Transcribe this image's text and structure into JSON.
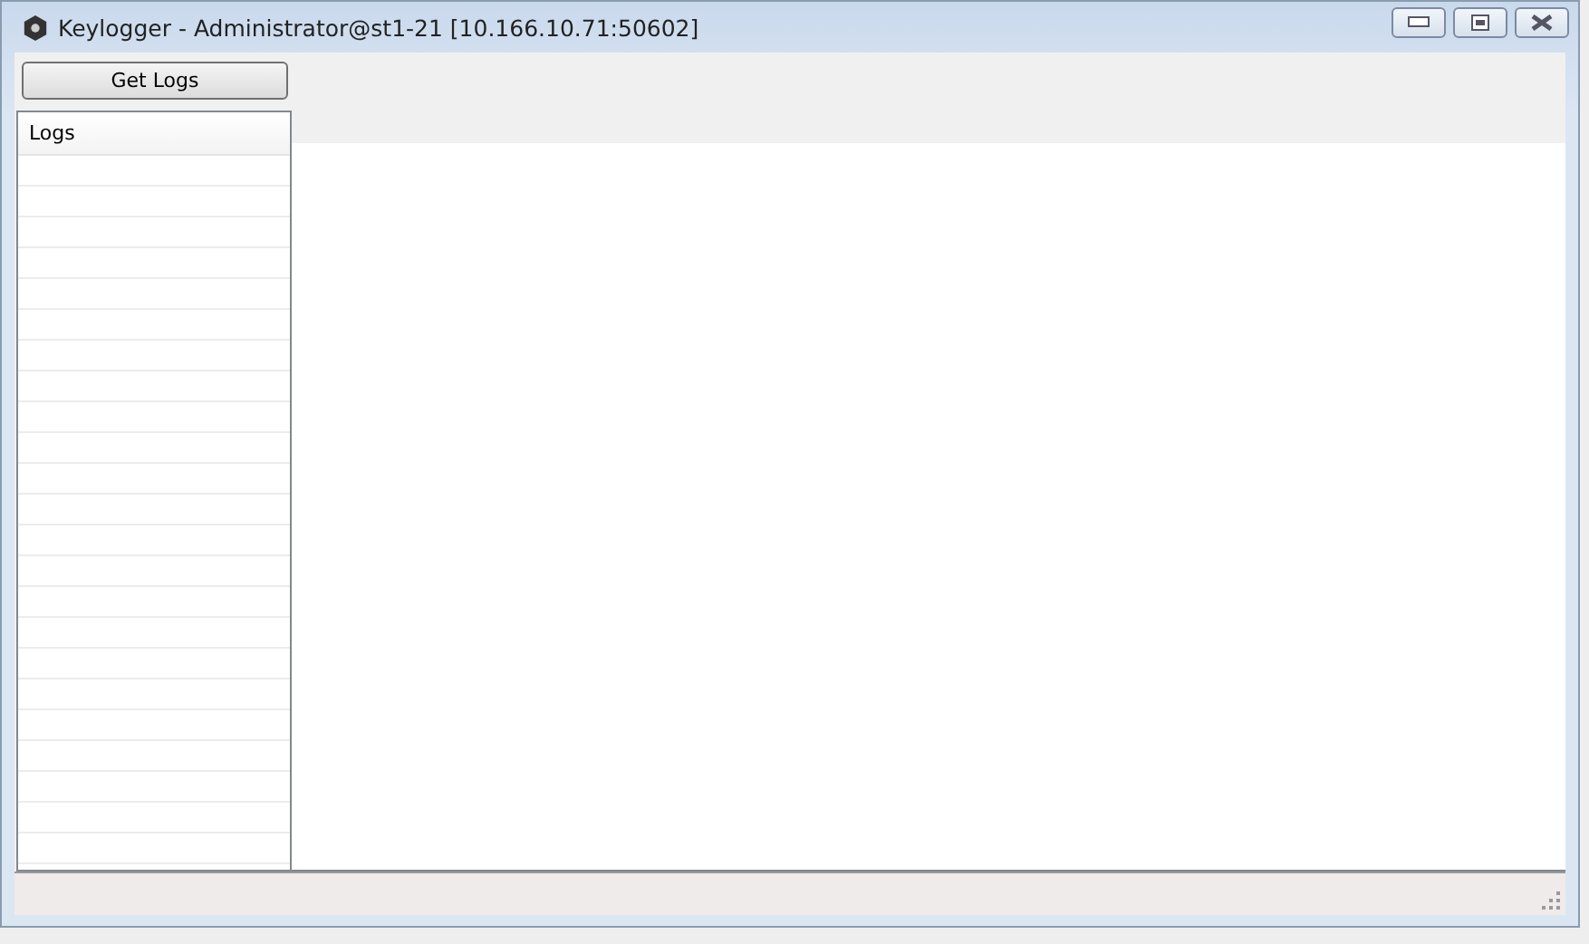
{
  "window": {
    "title": "Keylogger - Administrator@st1-21 [10.166.10.71:50602]"
  },
  "toolbar": {
    "buttons": [
      "Get Logs"
    ]
  },
  "logs_list": {
    "header": "Logs"
  }
}
